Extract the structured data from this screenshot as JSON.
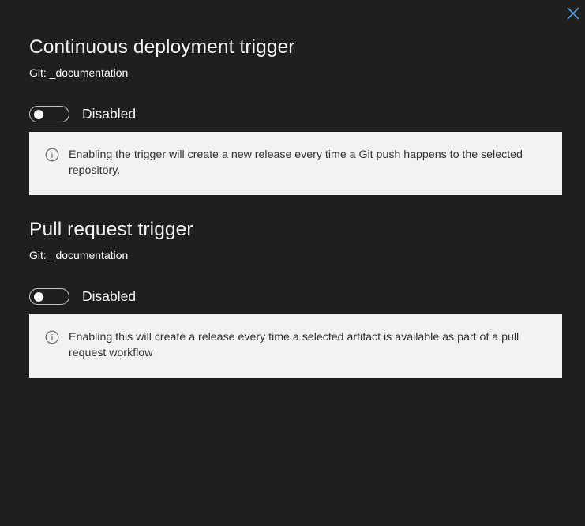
{
  "dialog": {
    "close_icon": "close-icon"
  },
  "sections": [
    {
      "title": "Continuous deployment trigger",
      "subtitle": "Git: _documentation",
      "toggle": {
        "state": "off",
        "label": "Disabled"
      },
      "info": {
        "icon": "info-icon",
        "text": "Enabling the trigger will create a new release every time a Git push happens to the selected repository."
      }
    },
    {
      "title": "Pull request trigger",
      "subtitle": "Git: _documentation",
      "toggle": {
        "state": "off",
        "label": "Disabled"
      },
      "info": {
        "icon": "info-icon",
        "text": "Enabling this will create a release every time a selected artifact is available as part of a pull request workflow"
      }
    }
  ],
  "colors": {
    "background": "#201f1e",
    "info_box": "#f3f2f1",
    "accent": "#4f9ee0"
  }
}
